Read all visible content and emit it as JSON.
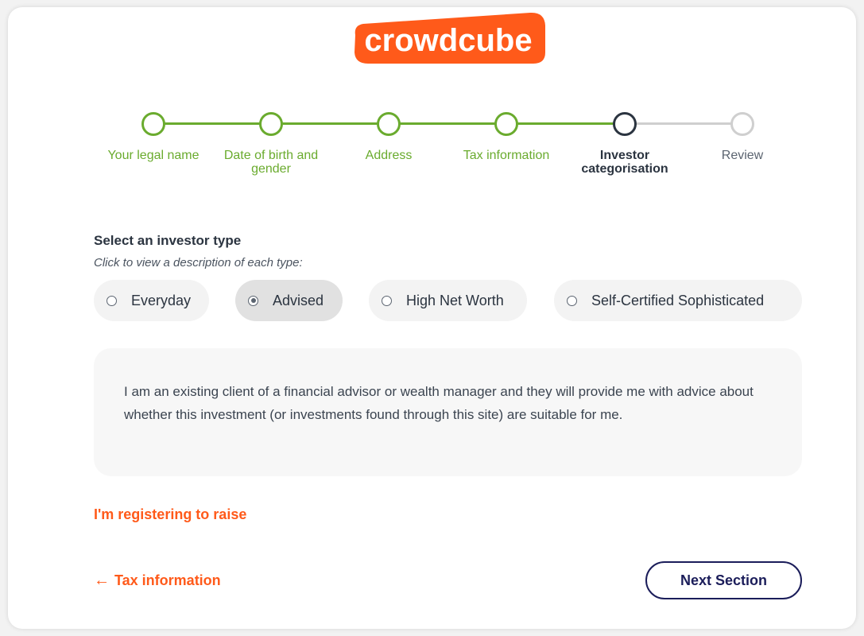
{
  "brand": {
    "logo_text": "crowdcube",
    "accent": "#ff5a1a",
    "complete_color": "#6aab2e"
  },
  "stepper": {
    "steps": [
      {
        "label": "Your legal name",
        "state": "complete"
      },
      {
        "label": "Date of birth and gender",
        "state": "complete"
      },
      {
        "label": "Address",
        "state": "complete"
      },
      {
        "label": "Tax information",
        "state": "complete"
      },
      {
        "label": "Investor categorisation",
        "state": "current"
      },
      {
        "label": "Review",
        "state": "todo"
      }
    ]
  },
  "investor_type": {
    "title": "Select an investor type",
    "hint": "Click to view a description of each type:",
    "options": [
      {
        "label": "Everyday",
        "selected": false
      },
      {
        "label": "Advised",
        "selected": true
      },
      {
        "label": "High Net Worth",
        "selected": false
      },
      {
        "label": "Self-Certified Sophisticated",
        "selected": false
      }
    ],
    "description": "I am an existing client of a financial advisor or wealth manager and they will provide me with advice about whether this investment (or investments found through this site) are suitable for me."
  },
  "links": {
    "raise": "I'm registering to raise",
    "back_arrow": "←",
    "back": "Tax information"
  },
  "buttons": {
    "next": "Next Section"
  }
}
